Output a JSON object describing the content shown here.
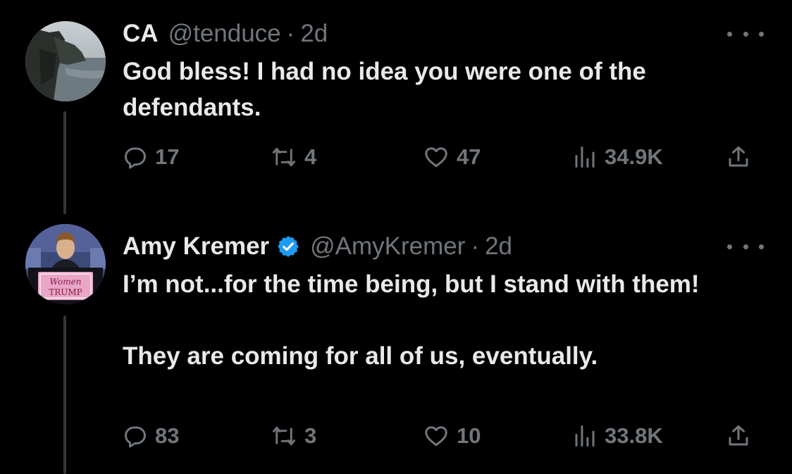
{
  "colors": {
    "background": "#000000",
    "primary_text": "#e7e9ea",
    "secondary_text": "#71767b",
    "thread_line": "#333639",
    "verified_badge": "#1d9bf0"
  },
  "tweets": [
    {
      "display_name": "CA",
      "handle": "@tenduce",
      "separator": "·",
      "time": "2d",
      "verified": false,
      "paragraphs": [
        "God bless! I had no idea you were one of the defendants."
      ],
      "stats": {
        "replies": "17",
        "reposts": "4",
        "likes": "47",
        "views": "34.9K"
      },
      "icons": {
        "reply": "reply-icon",
        "repost": "repost-icon",
        "like": "heart-icon",
        "views": "views-icon",
        "share": "share-icon",
        "more": "more-icon"
      }
    },
    {
      "display_name": "Amy Kremer",
      "handle": "@AmyKremer",
      "separator": "·",
      "time": "2d",
      "verified": true,
      "avatar_sign_text": [
        "Women",
        "TRUMP"
      ],
      "paragraphs": [
        "I’m not...for the time being, but I stand with them!",
        "They are coming for all of us, eventually."
      ],
      "stats": {
        "replies": "83",
        "reposts": "3",
        "likes": "10",
        "views": "33.8K"
      },
      "icons": {
        "reply": "reply-icon",
        "repost": "repost-icon",
        "like": "heart-icon",
        "views": "views-icon",
        "share": "share-icon",
        "more": "more-icon"
      }
    }
  ]
}
